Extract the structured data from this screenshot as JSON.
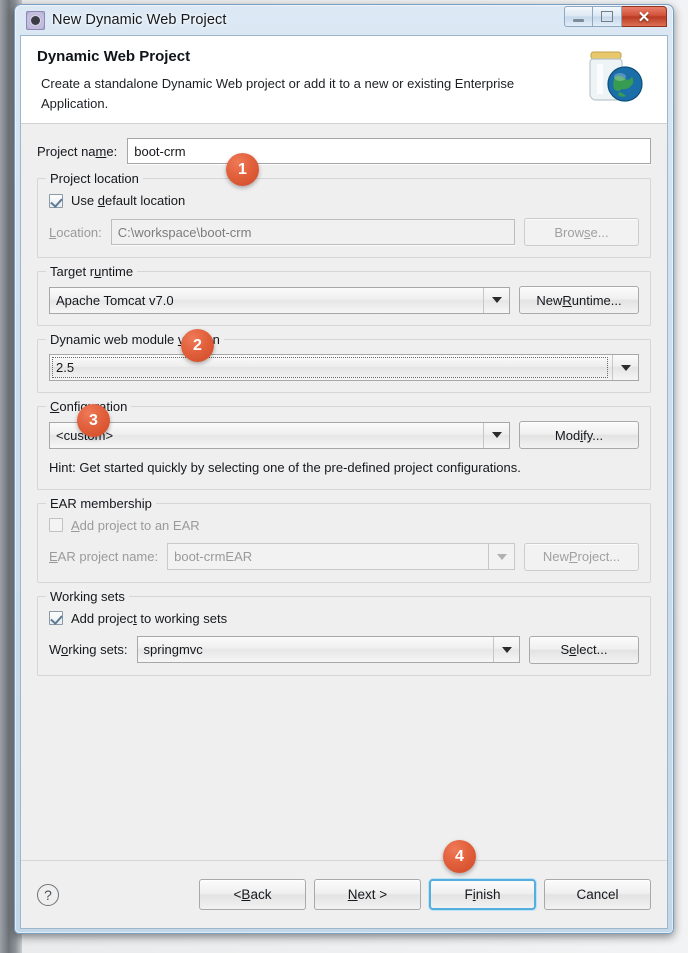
{
  "window": {
    "title": "New Dynamic Web Project",
    "icon": "eclipse-wizard-icon",
    "caption": {
      "minimize": "minimize-icon",
      "maximize": "restore-icon",
      "close": "✕"
    }
  },
  "banner": {
    "title": "Dynamic Web Project",
    "description": "Create a standalone Dynamic Web project or add it to a new or existing Enterprise Application.",
    "icon": "jar-globe-icon"
  },
  "form": {
    "project_name": {
      "label_pre": "Project na",
      "label_mn": "m",
      "label_post": "e:",
      "value": "boot-crm"
    },
    "project_location": {
      "group_title": "Project location",
      "use_default_pre": "Use ",
      "use_default_mn": "d",
      "use_default_post": "efault location",
      "use_default_checked": true,
      "location_label_mn": "L",
      "location_label_post": "ocation:",
      "location_value": "C:\\workspace\\boot-crm",
      "browse_pre": "Brow",
      "browse_mn": "s",
      "browse_post": "e..."
    },
    "target_runtime": {
      "group_title_pre": "Target r",
      "group_title_mn": "u",
      "group_title_post": "ntime",
      "value": "Apache Tomcat v7.0",
      "new_runtime_pre": "New ",
      "new_runtime_mn": "R",
      "new_runtime_post": "untime..."
    },
    "module_version": {
      "group_title_pre": "Dynamic web module ",
      "group_title_mn": "v",
      "group_title_post": "ersion",
      "value": "2.5"
    },
    "configuration": {
      "group_title_mn": "C",
      "group_title_post": "onfiguration",
      "value": "<custom>",
      "modify_pre": "Mod",
      "modify_mn": "i",
      "modify_post": "fy...",
      "hint": "Hint: Get started quickly by selecting one of the pre-defined project configurations."
    },
    "ear_membership": {
      "group_title": "EAR membership",
      "add_to_ear_mn": "A",
      "add_to_ear_post": "dd project to an EAR",
      "add_to_ear_checked": false,
      "ear_name_label_mn": "E",
      "ear_name_label_post": "AR project name:",
      "ear_name_value": "boot-crmEAR",
      "new_project_pre": "New ",
      "new_project_mn": "P",
      "new_project_post": "roject..."
    },
    "working_sets": {
      "group_title": "Working sets",
      "add_to_ws_pre": "Add projec",
      "add_to_ws_mn": "t",
      "add_to_ws_post": " to working sets",
      "add_to_ws_checked": true,
      "ws_label_pre": "W",
      "ws_label_mn": "o",
      "ws_label_post": "rking sets:",
      "ws_value": "springmvc",
      "select_pre": "S",
      "select_mn": "e",
      "select_post": "lect..."
    }
  },
  "footer": {
    "help": "?",
    "back_pre": "< ",
    "back_mn": "B",
    "back_post": "ack",
    "next_mn": "N",
    "next_post": "ext >",
    "finish_pre": "F",
    "finish_mn": "i",
    "finish_post": "nish",
    "cancel": "Cancel"
  },
  "badges": {
    "one": "1",
    "two": "2",
    "three": "3",
    "four": "4",
    "color": "#e05a3c"
  }
}
